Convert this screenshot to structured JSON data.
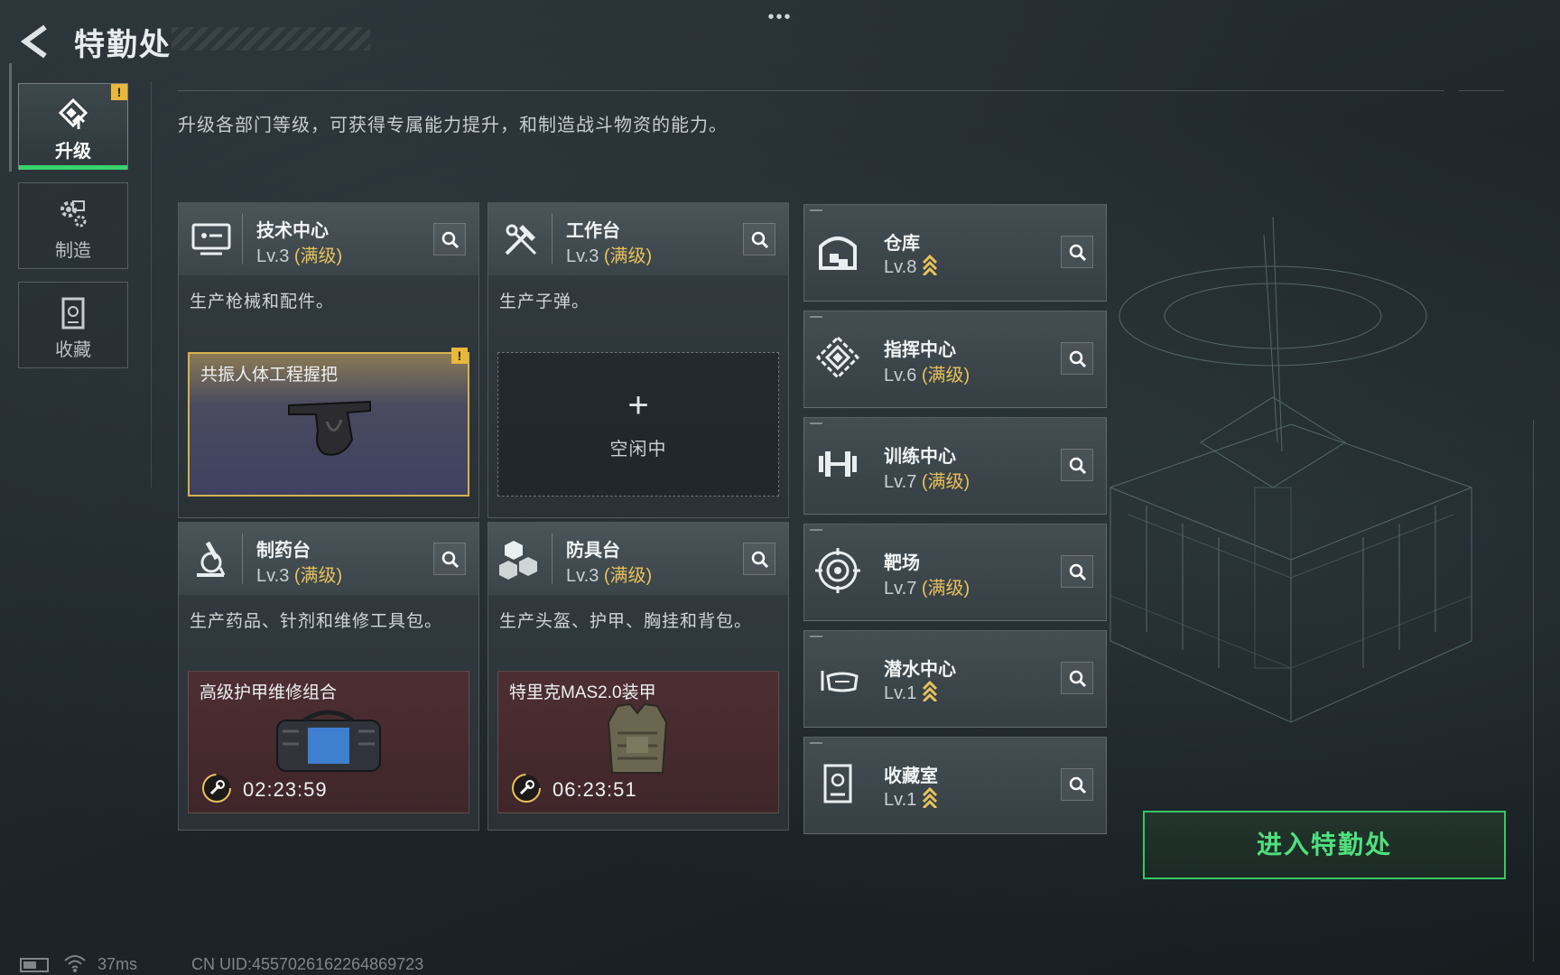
{
  "header": {
    "title": "特勤处",
    "menu_dots": "•••"
  },
  "description": "升级各部门等级，可获得专属能力提升，和制造战斗物资的能力。",
  "nav": [
    {
      "label": "升级",
      "icon": "upgrade-icon",
      "active": true,
      "badge": "!"
    },
    {
      "label": "制造",
      "icon": "gears-icon",
      "active": false
    },
    {
      "label": "收藏",
      "icon": "collection-icon",
      "active": false
    }
  ],
  "cards": {
    "tech": {
      "name": "技术中心",
      "level": "Lv.3",
      "maxed": "(满级)",
      "icon": "computer-icon",
      "desc": "生产枪械和配件。",
      "slot": {
        "name": "共振人体工程握把",
        "badge": "!"
      }
    },
    "workbench": {
      "name": "工作台",
      "level": "Lv.3",
      "maxed": "(满级)",
      "icon": "tools-icon",
      "desc": "生产子弹。",
      "slot": {
        "plus": "+",
        "status": "空闲中"
      }
    },
    "pharmacy": {
      "name": "制药台",
      "level": "Lv.3",
      "maxed": "(满级)",
      "icon": "microscope-icon",
      "desc": "生产药品、针剂和维修工具包。",
      "slot": {
        "name": "高级护甲维修组合",
        "timer": "02:23:59"
      }
    },
    "armor": {
      "name": "防具台",
      "level": "Lv.3",
      "maxed": "(满级)",
      "icon": "cubes-icon",
      "desc": "生产头盔、护甲、胸挂和背包。",
      "slot": {
        "name": "特里克MAS2.0装甲",
        "timer": "06:23:51"
      }
    }
  },
  "rows": [
    {
      "name": "仓库",
      "level": "Lv.8",
      "maxed": "",
      "upgradable": true,
      "icon": "warehouse-icon"
    },
    {
      "name": "指挥中心",
      "level": "Lv.6",
      "maxed": "(满级)",
      "upgradable": false,
      "icon": "command-icon"
    },
    {
      "name": "训练中心",
      "level": "Lv.7",
      "maxed": "(满级)",
      "upgradable": false,
      "icon": "dumbbell-icon"
    },
    {
      "name": "靶场",
      "level": "Lv.7",
      "maxed": "(满级)",
      "upgradable": false,
      "icon": "target-icon"
    },
    {
      "name": "潜水中心",
      "level": "Lv.1",
      "maxed": "",
      "upgradable": true,
      "icon": "diving-mask-icon"
    },
    {
      "name": "收藏室",
      "level": "Lv.1",
      "maxed": "",
      "upgradable": true,
      "icon": "collection-room-icon"
    }
  ],
  "enter_button": "进入特勤处",
  "footer": {
    "ping": "37ms",
    "uid": "CN UID:4557026162264869723"
  },
  "colors": {
    "accent_green": "#37d46a",
    "gold": "#e8c25a",
    "warning": "#e9b83a"
  }
}
